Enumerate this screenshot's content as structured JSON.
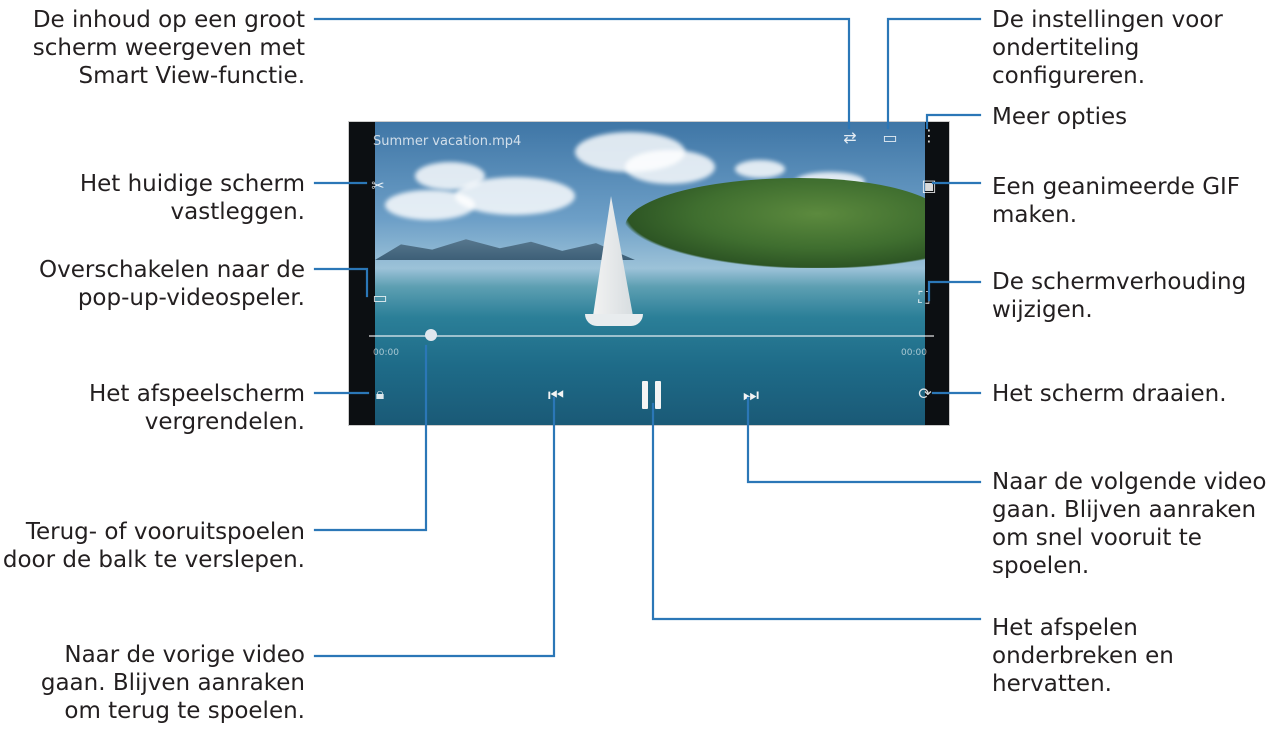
{
  "video": {
    "file_title": "Summer vacation.mp4",
    "elapsed": "00:00",
    "duration": "00:00",
    "progress_fraction": 0.11
  },
  "callouts": {
    "smart_view": "De inhoud op een groot\nscherm weergeven met\nSmart View-functie.",
    "capture": "Het huidige scherm\nvastleggen.",
    "popup": "Overschakelen naar de\npop-up-videospeler.",
    "lock": "Het afspeelscherm\nvergrendelen.",
    "seek": "Terug- of vooruitspoelen\ndoor de balk te verslepen.",
    "previous": "Naar de vorige video\ngaan. Blijven aanraken\nom terug te spoelen.",
    "subtitles": "De instellingen voor\nondertiteling\nconfigureren.",
    "more": "Meer opties",
    "gif": "Een geanimeerde GIF\nmaken.",
    "ratio": "De schermverhouding\nwijzigen.",
    "rotate": "Het scherm draaien.",
    "next": "Naar de volgende video\ngaan. Blijven aanraken\nom snel vooruit te\nspoelen.",
    "pause": "Het afspelen\nonderbreken en\nhervatten."
  },
  "icons": {
    "cast": "smart-view-icon",
    "subtitle": "subtitle-icon",
    "more": "more-options-icon",
    "capture": "capture-icon",
    "gif": "gif-icon",
    "popup": "popup-player-icon",
    "ratio": "aspect-ratio-icon",
    "lock": "lock-icon",
    "rotate": "rotate-icon",
    "prev": "previous-icon",
    "pause": "pause-icon",
    "next": "next-icon"
  },
  "colors": {
    "leader_lines": "#2b77b7",
    "text": "#231f20"
  }
}
